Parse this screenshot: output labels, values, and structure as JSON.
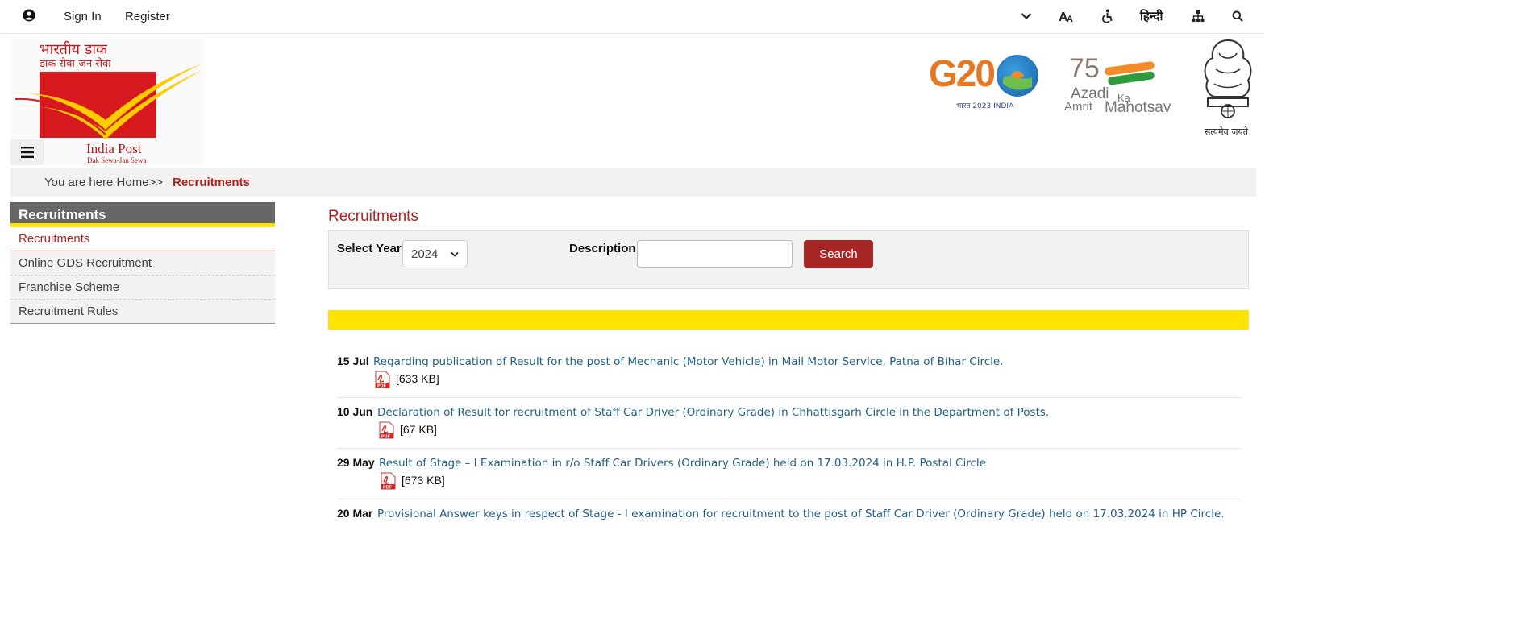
{
  "topbar": {
    "sign_in": "Sign In",
    "register": "Register",
    "hindi": "हिन्दी",
    "icons": [
      "user-icon",
      "chevron-down-icon",
      "font-size-icon",
      "accessibility-icon",
      "sitemap-icon",
      "search-icon"
    ]
  },
  "header": {
    "logo_hindi_line1": "भारतीय डाक",
    "logo_hindi_line2": "डाक सेवा-जन सेवा",
    "logo_name": "India Post",
    "logo_tagline": "Dak Sewa-Jan Sewa",
    "g20_text": "G20",
    "g20_sub": "भारत 2023 INDIA",
    "azadi_75": "75",
    "azadi_line1": "Azadi",
    "azadi_ka": "Ka",
    "azadi_line2a": "Amrit",
    "azadi_line2b": "Mahotsav",
    "emblem_text": "सत्यमेव जयते"
  },
  "breadcrumb": {
    "prefix": "You are here Home>>",
    "current": "Recruitments"
  },
  "sidebar": {
    "title": "Recruitments",
    "items": [
      {
        "label": "Recruitments"
      },
      {
        "label": "Online GDS Recruitment"
      },
      {
        "label": "Franchise Scheme"
      },
      {
        "label": "Recruitment Rules"
      }
    ]
  },
  "main": {
    "title": "Recruitments",
    "filter": {
      "year_label": "Select Year",
      "year_value": "2024",
      "description_label": "Description",
      "description_value": "",
      "search_label": "Search"
    },
    "items": [
      {
        "date": "15 Jul",
        "title": "Regarding publication of Result for the post of Mechanic (Motor Vehicle) in Mail Motor Service, Patna of Bihar Circle.",
        "size": "[633 KB]"
      },
      {
        "date": "10 Jun",
        "title": "Declaration of Result for recruitment of Staff Car Driver (Ordinary Grade) in Chhattisgarh Circle in the Department of Posts.",
        "size": "[67 KB]"
      },
      {
        "date": "29 May",
        "title": "Result of Stage – I Examination in r/o Staff Car Drivers (Ordinary Grade) held on 17.03.2024 in H.P. Postal Circle",
        "size": "[673 KB]"
      },
      {
        "date": "20 Mar",
        "title": "Provisional Answer keys in respect of Stage - I examination for recruitment to the post of Staff Car Driver (Ordinary Grade) held on 17.03.2024 in HP Circle.",
        "size": ""
      }
    ]
  },
  "colors": {
    "accent_red": "#b22222",
    "button_red": "#a52424",
    "highlight_yellow": "#ffe400",
    "link_blue": "#1f5f8b"
  }
}
